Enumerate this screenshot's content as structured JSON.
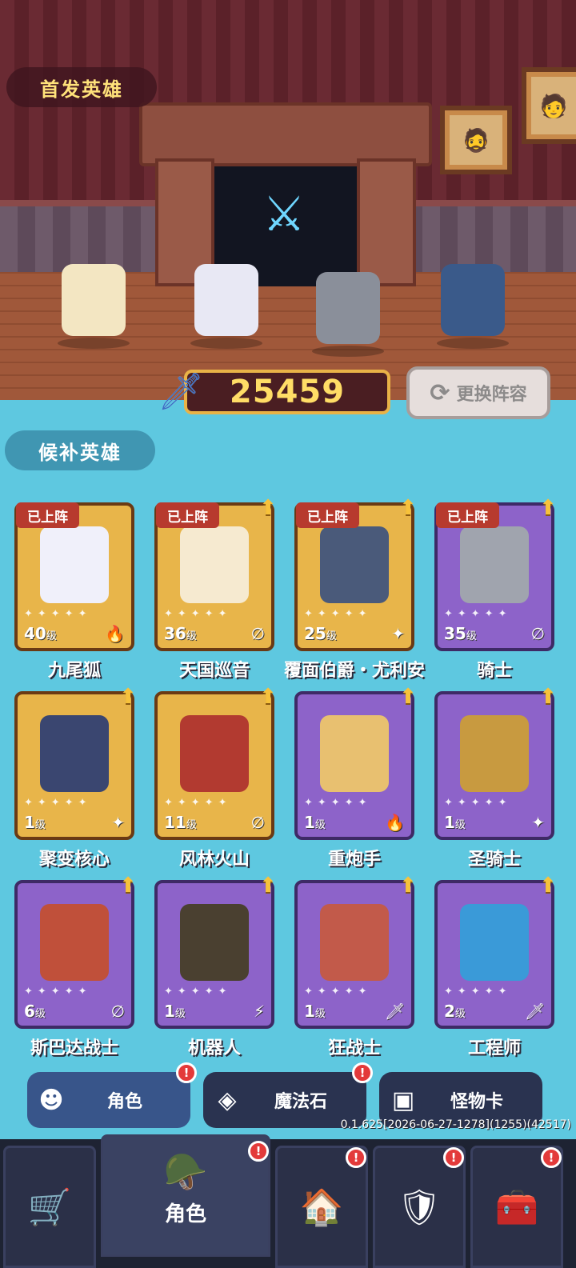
{
  "lineup": {
    "title": "首发英雄",
    "power": "25459",
    "swap_label": "更换阵容"
  },
  "bench": {
    "title": "候补英雄",
    "cards": [
      {
        "name": "九尾狐",
        "level": "40",
        "level_unit": "级",
        "badge": "已上阵",
        "rarity": "gold",
        "element": "🔥",
        "upgrade": false
      },
      {
        "name": "天国巡音",
        "level": "36",
        "level_unit": "级",
        "badge": "已上阵",
        "rarity": "gold",
        "element": "∅",
        "upgrade": true
      },
      {
        "name": "覆面伯爵・尤利安",
        "level": "25",
        "level_unit": "级",
        "badge": "已上阵",
        "rarity": "gold",
        "element": "✦",
        "upgrade": true
      },
      {
        "name": "骑士",
        "level": "35",
        "level_unit": "级",
        "badge": "已上阵",
        "rarity": "purple",
        "element": "∅",
        "upgrade": true
      },
      {
        "name": "聚变核心",
        "level": "1",
        "level_unit": "级",
        "badge": "",
        "rarity": "gold",
        "element": "✦",
        "upgrade": true
      },
      {
        "name": "风林火山",
        "level": "11",
        "level_unit": "级",
        "badge": "",
        "rarity": "gold",
        "element": "∅",
        "upgrade": true
      },
      {
        "name": "重炮手",
        "level": "1",
        "level_unit": "级",
        "badge": "",
        "rarity": "purple",
        "element": "🔥",
        "upgrade": true
      },
      {
        "name": "圣骑士",
        "level": "1",
        "level_unit": "级",
        "badge": "",
        "rarity": "purple",
        "element": "✦",
        "upgrade": true
      },
      {
        "name": "斯巴达战士",
        "level": "6",
        "level_unit": "级",
        "badge": "",
        "rarity": "purple",
        "element": "∅",
        "upgrade": true
      },
      {
        "name": "机器人",
        "level": "1",
        "level_unit": "级",
        "badge": "",
        "rarity": "purple",
        "element": "⚡",
        "upgrade": true
      },
      {
        "name": "狂战士",
        "level": "1",
        "level_unit": "级",
        "badge": "",
        "rarity": "purple",
        "element": "🗡",
        "upgrade": true
      },
      {
        "name": "工程师",
        "level": "2",
        "level_unit": "级",
        "badge": "",
        "rarity": "purple",
        "element": "🗡",
        "upgrade": true
      }
    ]
  },
  "subtabs": [
    {
      "label": "角色",
      "icon": "character-icon"
    },
    {
      "label": "魔法石",
      "icon": "magic-stone-icon"
    },
    {
      "label": "怪物卡",
      "icon": "monster-card-icon"
    }
  ],
  "alert_mark": "!",
  "version": "0.1.625[2026-06-27-1278](1255)(42517)",
  "nav": {
    "active_label": "角色",
    "items": [
      "shop-icon",
      "character-icon",
      "home-icon",
      "guild-icon",
      "treasure-icon"
    ]
  },
  "colors": {
    "gold_card": "#e8b54a",
    "purple_card": "#8d63c9",
    "badge": "#b73a2e",
    "power_text": "#ffdd66"
  }
}
